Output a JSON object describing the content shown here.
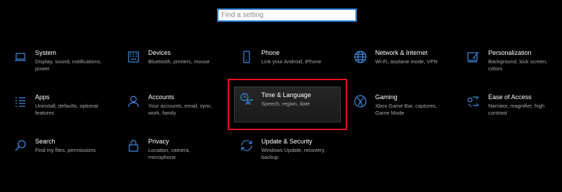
{
  "search": {
    "placeholder": "Find a setting"
  },
  "tiles": [
    {
      "title": "System",
      "desc": "Display, sound, notifications, power",
      "icon": "laptop-icon"
    },
    {
      "title": "Devices",
      "desc": "Bluetooth, printers, mouse",
      "icon": "keyboard-icon"
    },
    {
      "title": "Phone",
      "desc": "Link your Android, iPhone",
      "icon": "phone-icon"
    },
    {
      "title": "Network & Internet",
      "desc": "Wi-Fi, airplane mode, VPN",
      "icon": "globe-icon"
    },
    {
      "title": "Personalization",
      "desc": "Background, lock screen, colors",
      "icon": "paint-icon"
    },
    {
      "title": "Apps",
      "desc": "Uninstall, defaults, optional features",
      "icon": "apps-list-icon"
    },
    {
      "title": "Accounts",
      "desc": "Your accounts, email, sync, work, family",
      "icon": "person-icon"
    },
    {
      "title": "Time & Language",
      "desc": "Speech, region, date",
      "icon": "time-language-icon"
    },
    {
      "title": "Gaming",
      "desc": "Xbox Game Bar, captures, Game Mode",
      "icon": "xbox-icon"
    },
    {
      "title": "Ease of Access",
      "desc": "Narrator, magnifier, high contrast",
      "icon": "ease-of-access-icon"
    },
    {
      "title": "Search",
      "desc": "Find my files, permissions",
      "icon": "search-icon"
    },
    {
      "title": "Privacy",
      "desc": "Location, camera, microphone",
      "icon": "lock-icon"
    },
    {
      "title": "Update & Security",
      "desc": "Windows Update, recovery, backup",
      "icon": "sync-icon"
    }
  ],
  "colors": {
    "accent": "#2d7dd2",
    "highlight": "#e3101a",
    "icon": "#3c8be0"
  }
}
